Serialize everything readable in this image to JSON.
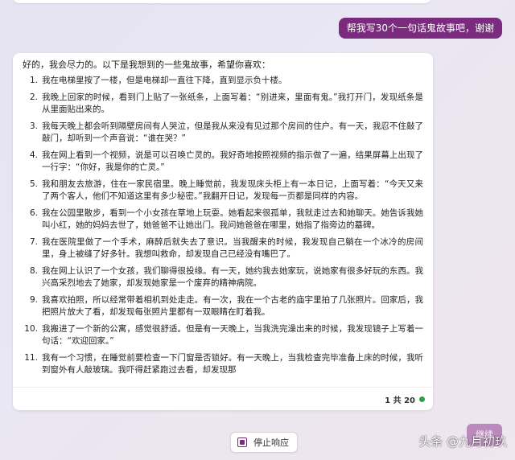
{
  "user_message": "帮我写30个一句话鬼故事吧，谢谢",
  "response": {
    "intro": "好的，我会尽力的。以下是我想到的一些鬼故事，希望你喜欢：",
    "items": [
      {
        "num": "1.",
        "text": "我在电梯里按了一楼，但是电梯却一直往下降，直到显示负十楼。"
      },
      {
        "num": "2.",
        "text": "我晚上回家的时候，看到门上贴了一张纸条，上面写着：“别进来，里面有鬼。”我打开门，发现纸条是从里面贴出来的。"
      },
      {
        "num": "3.",
        "text": "我每天晚上都会听到隔壁房间有人哭泣，但是我从来没有见过那个房间的住户。有一天，我忍不住敲了敲门，却听到一个声音说：“谁在哭？”"
      },
      {
        "num": "4.",
        "text": "我在网上看到一个视频，说是可以召唤亡灵的。我好奇地按照视频的指示做了一遍，结果屏幕上出现了一行字：“你好，我是你的亡灵。”"
      },
      {
        "num": "5.",
        "text": "我和朋友去旅游，住在一家民宿里。晚上睡觉前，我发现床头柜上有一本日记，上面写着：“今天又来了两个客人，他们不知道这里有多少秘密。”我翻开日记，发现每一页都是同样的内容。"
      },
      {
        "num": "6.",
        "text": "我在公园里散步，看到一个小女孩在草地上玩耍。她看起来很孤单，我就走过去和她聊天。她告诉我她叫小红，她的妈妈去世了，她爸爸不让她出门。我问她爸爸在哪里，她指了指旁边的墓碑。"
      },
      {
        "num": "7.",
        "text": "我在医院里做了一个手术，麻醉后就失去了意识。当我醒来的时候，我发现自己躺在一个冰冷的房间里，身上被缝了好多针。我想叫救命，却发现自己已经没有嘴巴了。"
      },
      {
        "num": "8.",
        "text": "我在网上认识了一个女孩，我们聊得很投缘。有一天，她约我去她家玩，说她家有很多好玩的东西。我兴高采烈地去了她家，却发现她家是一个废弃的精神病院。"
      },
      {
        "num": "9.",
        "text": "我喜欢拍照，所以经常带着相机到处走走。有一次，我在一个古老的庙宇里拍了几张照片。回家后，我把照片放大了看，却发现每张照片里都有一双眼睛在盯着我。"
      },
      {
        "num": "10.",
        "text": "我搬进了一个新的公寓，感觉很舒适。但是有一天晚上，当我洗完澡出来的时候，我发现镜子上写着一句话：“欢迎回家。”"
      },
      {
        "num": "11.",
        "text": "我有一个习惯，在睡觉前要检查一下门窗是否锁好。有一天晚上，当我检查完毕准备上床的时候，我听到窗外有人敲玻璃。我吓得赶紧跑过去看，却发现那"
      }
    ],
    "counter": "1 共 20"
  },
  "stop_button_label": "停止响应",
  "continue_button_label": "继续",
  "watermark": "头条 @九月初玖",
  "colors": {
    "accent": "#7b2b7d",
    "status_dot": "#2e9d4e",
    "user_bubble_text": "#ffffff"
  }
}
